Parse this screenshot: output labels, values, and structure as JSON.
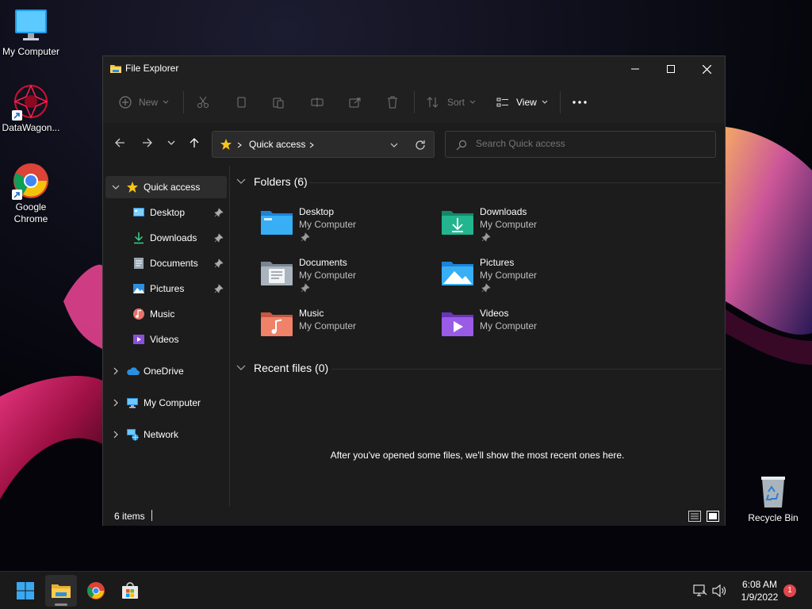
{
  "desktop": {
    "icons": [
      {
        "label": "My Computer"
      },
      {
        "label": "DataWagon..."
      },
      {
        "label": "Google Chrome"
      },
      {
        "label": "Recycle Bin"
      }
    ]
  },
  "window": {
    "title": "File Explorer",
    "commands": {
      "new": "New",
      "sort": "Sort",
      "view": "View"
    },
    "address": {
      "breadcrumb": "Quick access"
    },
    "search": {
      "placeholder": "Search Quick access"
    },
    "nav": {
      "items": [
        {
          "label": "Quick access",
          "icon": "star-icon"
        },
        {
          "label": "Desktop",
          "icon": "desktop-icon"
        },
        {
          "label": "Downloads",
          "icon": "download-icon"
        },
        {
          "label": "Documents",
          "icon": "document-icon"
        },
        {
          "label": "Pictures",
          "icon": "pictures-icon"
        },
        {
          "label": "Music",
          "icon": "music-icon"
        },
        {
          "label": "Videos",
          "icon": "videos-icon"
        },
        {
          "label": "OneDrive",
          "icon": "cloud-icon"
        },
        {
          "label": "My Computer",
          "icon": "computer-icon"
        },
        {
          "label": "Network",
          "icon": "network-icon"
        }
      ]
    },
    "folders_header": "Folders (6)",
    "folders": [
      {
        "name": "Desktop",
        "location": "My Computer",
        "pinned": true
      },
      {
        "name": "Downloads",
        "location": "My Computer",
        "pinned": true
      },
      {
        "name": "Documents",
        "location": "My Computer",
        "pinned": true
      },
      {
        "name": "Pictures",
        "location": "My Computer",
        "pinned": true
      },
      {
        "name": "Music",
        "location": "My Computer",
        "pinned": false
      },
      {
        "name": "Videos",
        "location": "My Computer",
        "pinned": false
      }
    ],
    "recent_header": "Recent files (0)",
    "recent_empty": "After you've opened some files, we'll show the most recent ones here.",
    "status": "6 items"
  },
  "taskbar": {
    "time": "6:08 AM",
    "date": "1/9/2022",
    "notifications": "1"
  },
  "colors": {
    "accent": "#60cdff",
    "window_bg": "#1c1c1c",
    "star": "#f5c518",
    "notification": "#e0474c"
  }
}
